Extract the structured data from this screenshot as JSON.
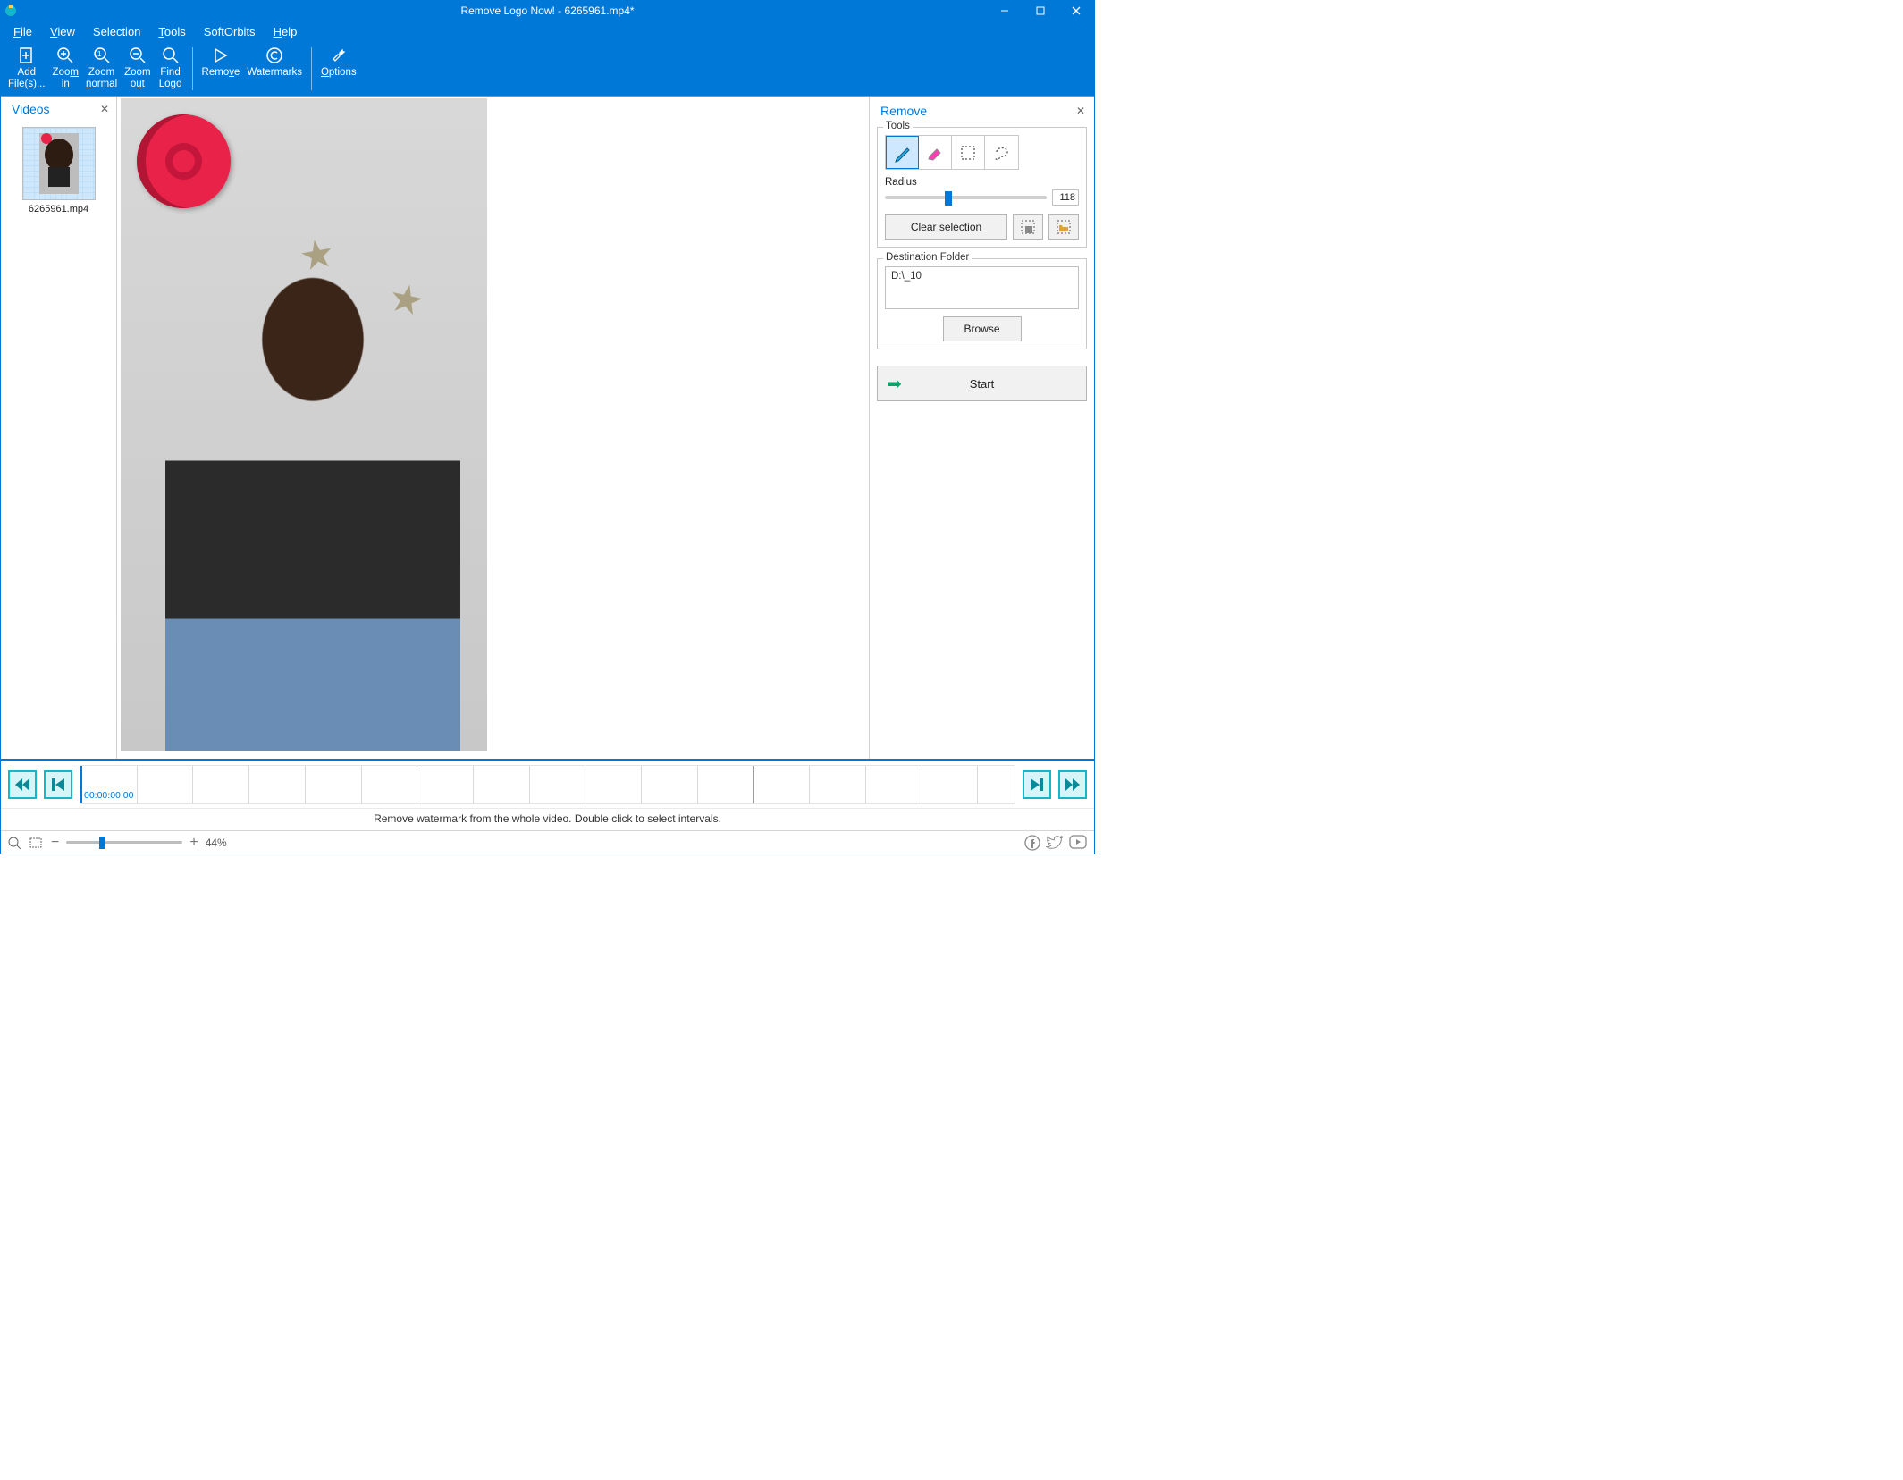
{
  "window": {
    "title": "Remove Logo Now! - 6265961.mp4*"
  },
  "menu": {
    "file": "File",
    "view": "View",
    "selection": "Selection",
    "tools": "Tools",
    "softorbits": "SoftOrbits",
    "help": "Help"
  },
  "toolbar": {
    "add_files": "Add\nFile(s)...",
    "zoom_in": "Zoom\nin",
    "zoom_normal": "Zoom\nnormal",
    "zoom_out": "Zoom\nout",
    "find_logo": "Find\nLogo",
    "remove": "Remove",
    "watermarks": "Watermarks",
    "options": "Options"
  },
  "left_panel": {
    "title": "Videos",
    "thumb_label": "6265961.mp4"
  },
  "right_panel": {
    "title": "Remove",
    "tools_legend": "Tools",
    "radius_label": "Radius",
    "radius_value": "118",
    "clear_selection": "Clear selection",
    "dest_legend": "Destination Folder",
    "dest_path": "D:\\_10",
    "browse": "Browse",
    "start": "Start"
  },
  "timeline": {
    "time": "00:00:00 00",
    "hint": "Remove watermark from the whole video. Double click to select intervals."
  },
  "status": {
    "zoom_pct": "44%"
  }
}
